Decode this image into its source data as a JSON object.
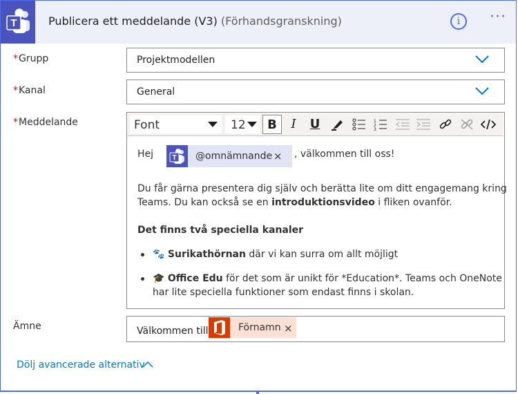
{
  "header": {
    "title": "Publicera ett meddelande (V3)",
    "subtitle": "(Förhandsgranskning)",
    "info_icon_text": "i",
    "more_text": "···",
    "app_icon": "teams-icon",
    "colors": {
      "header_bg": "#edf0f9",
      "accent": "#4f6bed",
      "teams": "#4b53bc"
    }
  },
  "fields": {
    "required_mark": "*",
    "group_label": "Grupp",
    "group_value": "Projektmodellen",
    "channel_label": "Kanal",
    "channel_value": "General",
    "message_label": "Meddelande",
    "subject_label": "Ämne"
  },
  "toolbar": {
    "font": "Font",
    "size": "12",
    "bold": "B",
    "italic": "I",
    "underline": "U",
    "icons": [
      "highlight-icon",
      "bullet-list-icon",
      "numbered-list-icon",
      "decrease-indent-icon",
      "increase-indent-icon",
      "link-icon",
      "unlink-icon",
      "code-view-icon"
    ]
  },
  "message": {
    "greeting": "Hej",
    "mention_token": "@omnämnande",
    "token_close": "×",
    "after_mention": ", välkommen till oss!",
    "para1_line1": "Du får gärna presentera dig själv och berätta lite om ditt engagemang kring",
    "para1_line2_start": "Teams. Du kan också se en ",
    "para1_line2_bold": "introduktionsvideo",
    "para1_line2_end": " i fliken ovanför.",
    "heading": "Det finns två speciella kanaler",
    "item1_emoji": "🐾",
    "item1_bold": "Surikathörnan",
    "item1_text": " där vi kan surra om allt möjligt",
    "item2_emoji": "🎓",
    "item2_bold": "Office Edu",
    "item2_text": " för det som är unikt för *Education*. Teams och OneNote",
    "item2_line2": "har lite speciella funktioner som endast finns i skolan."
  },
  "subject": {
    "prefix": "Välkommen till",
    "token": "Förnamn",
    "token_close": "×",
    "token_icon": "office-icon",
    "colors": {
      "token_bg": "#fbe0d6",
      "office": "#d83b01"
    }
  },
  "advanced_link": "Dölj avancerade alternativ"
}
